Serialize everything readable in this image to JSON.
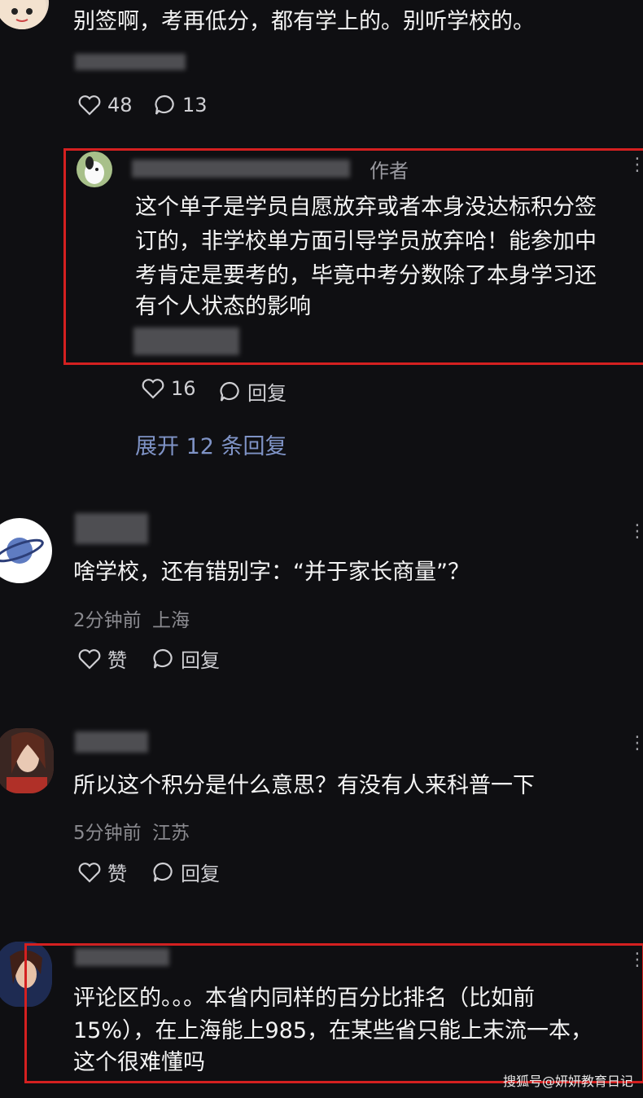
{
  "comment1": {
    "text": "别签啊，考再低分，都有学上的。别听学校的。",
    "likes": "48",
    "replies": "13"
  },
  "reply_author": {
    "badge": "作者",
    "text_lines": [
      "这个单子是学员自愿放弃或者本身没达标积分签",
      "订的，非学校单方面引导学员放弃哈！能参加中",
      "考肯定是要考的，毕竟中考分数除了本身学习还",
      "有个人状态的影响"
    ],
    "likes": "16",
    "reply_label": "回复",
    "expand_label": "展开 12 条回复"
  },
  "comment2": {
    "text": "啥学校，还有错别字：“并于家长商量”？",
    "time": "2分钟前",
    "location": "上海",
    "like_label": "赞",
    "reply_label": "回复"
  },
  "comment3": {
    "text": "所以这个积分是什么意思？有没有人来科普一下",
    "time": "5分钟前",
    "location": "江苏",
    "like_label": "赞",
    "reply_label": "回复"
  },
  "comment4": {
    "text_lines": [
      "评论区的。。。本省内同样的百分比排名（比如前",
      "15%），在上海能上985，在某些省只能上末流一本，",
      "这个很难懂吗"
    ]
  },
  "watermark": "搜狐号@妍妍教育日记",
  "colors": {
    "highlight": "#d42020",
    "link": "#7f93c6",
    "background": "#0f0f12"
  },
  "more_glyph": "⋮"
}
